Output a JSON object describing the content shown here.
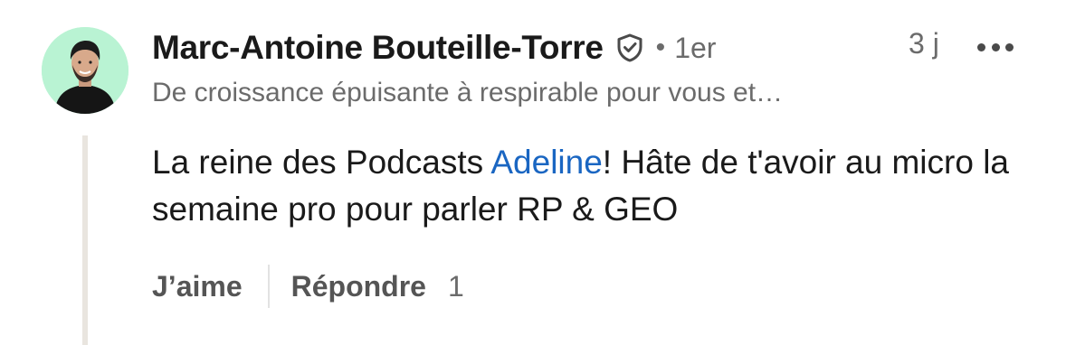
{
  "comment": {
    "author": {
      "name": "Marc-Antoine Bouteille-Torre",
      "connection_degree": "1er",
      "separator": "•",
      "headline": "De croissance épuisante à respirable pour vous et…",
      "verified_icon": "shield-check-icon",
      "avatar_background": "#b9f3d3"
    },
    "timestamp": "3 j",
    "more_icon": "more-horizontal-icon",
    "body": {
      "before_mention": "La reine des Podcasts ",
      "mention": "Adeline",
      "after_mention": "! Hâte de t'avoir au micro la semaine pro pour parler RP & GEO"
    },
    "actions": {
      "like_label": "J’aime",
      "reply_label": "Répondre",
      "reply_count": "1"
    },
    "colors": {
      "mention": "#1a66c2",
      "text_primary": "#1a1a1a",
      "text_secondary": "#6b6b6b",
      "thread_line": "#e9e5df"
    }
  }
}
